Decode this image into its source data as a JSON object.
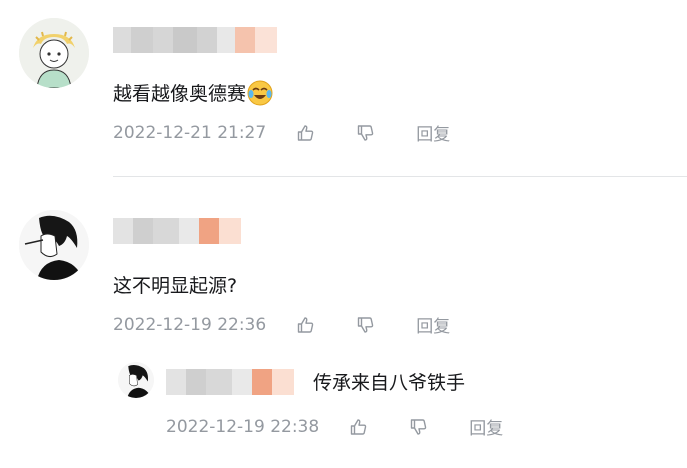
{
  "comments": [
    {
      "content": "越看越像奥德赛",
      "emoji": "cry-laugh-emoji",
      "time": "2022-12-21 21:27",
      "reply_label": "回复"
    },
    {
      "content": "这不明显起源?",
      "time": "2022-12-19 22:36",
      "reply_label": "回复"
    }
  ],
  "sub_reply": {
    "content": "传承来自八爷铁手",
    "time": "2022-12-19 22:38",
    "reply_label": "回复"
  },
  "icons": {
    "like": "thumbs-up-icon",
    "dislike": "thumbs-down-icon"
  },
  "colors": {
    "meta_text": "#9499a0",
    "divider": "#e3e5e7",
    "blur_accent": "#f2a98a"
  }
}
